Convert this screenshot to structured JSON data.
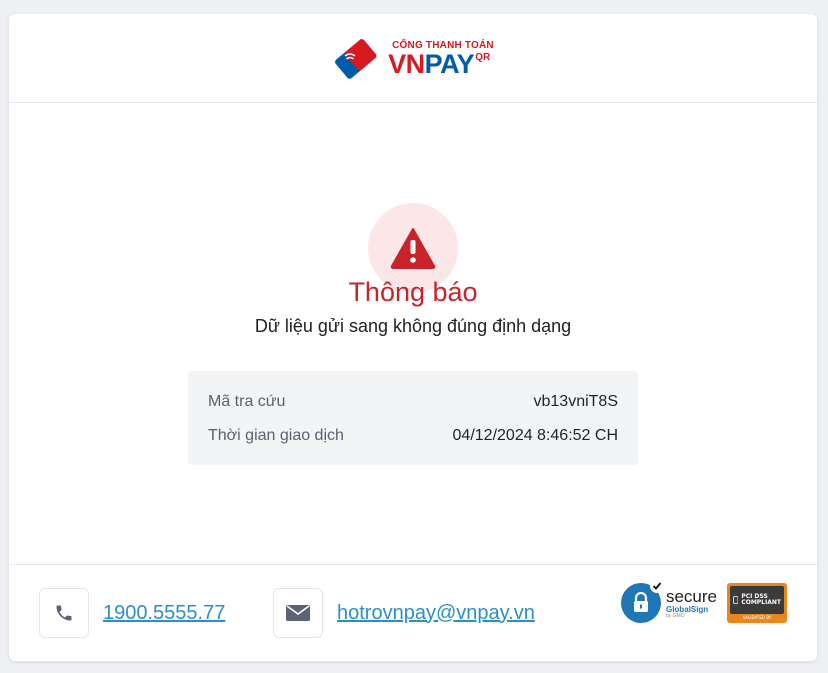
{
  "brand": {
    "tagline": "CỔNG THANH TOÁN",
    "name_part1": "VN",
    "name_part2": "PAY",
    "name_suffix": "QR",
    "colors": {
      "red": "#d71920",
      "blue": "#005baa"
    }
  },
  "notice": {
    "icon": "warning-triangle-icon",
    "title": "Thông báo",
    "message": "Dữ liệu gửi sang không đúng định dạng",
    "accent": "#c8232b"
  },
  "details": [
    {
      "label": "Mã tra cứu",
      "value": "vb13vniT8S"
    },
    {
      "label": "Thời gian giao dịch",
      "value": "04/12/2024 8:46:52 CH"
    }
  ],
  "footer": {
    "phone": {
      "icon": "phone-icon",
      "text": "1900.5555.77"
    },
    "email": {
      "icon": "mail-icon",
      "text": "hotrovnpay@vnpay.vn"
    },
    "secure_badge": {
      "word": "secure",
      "brand": "GlobalSign",
      "sub": "by GMO"
    },
    "pci_badge": {
      "line1": "PCI DSS",
      "line2": "COMPLIANT",
      "foot": "VALIDATED BY"
    }
  }
}
